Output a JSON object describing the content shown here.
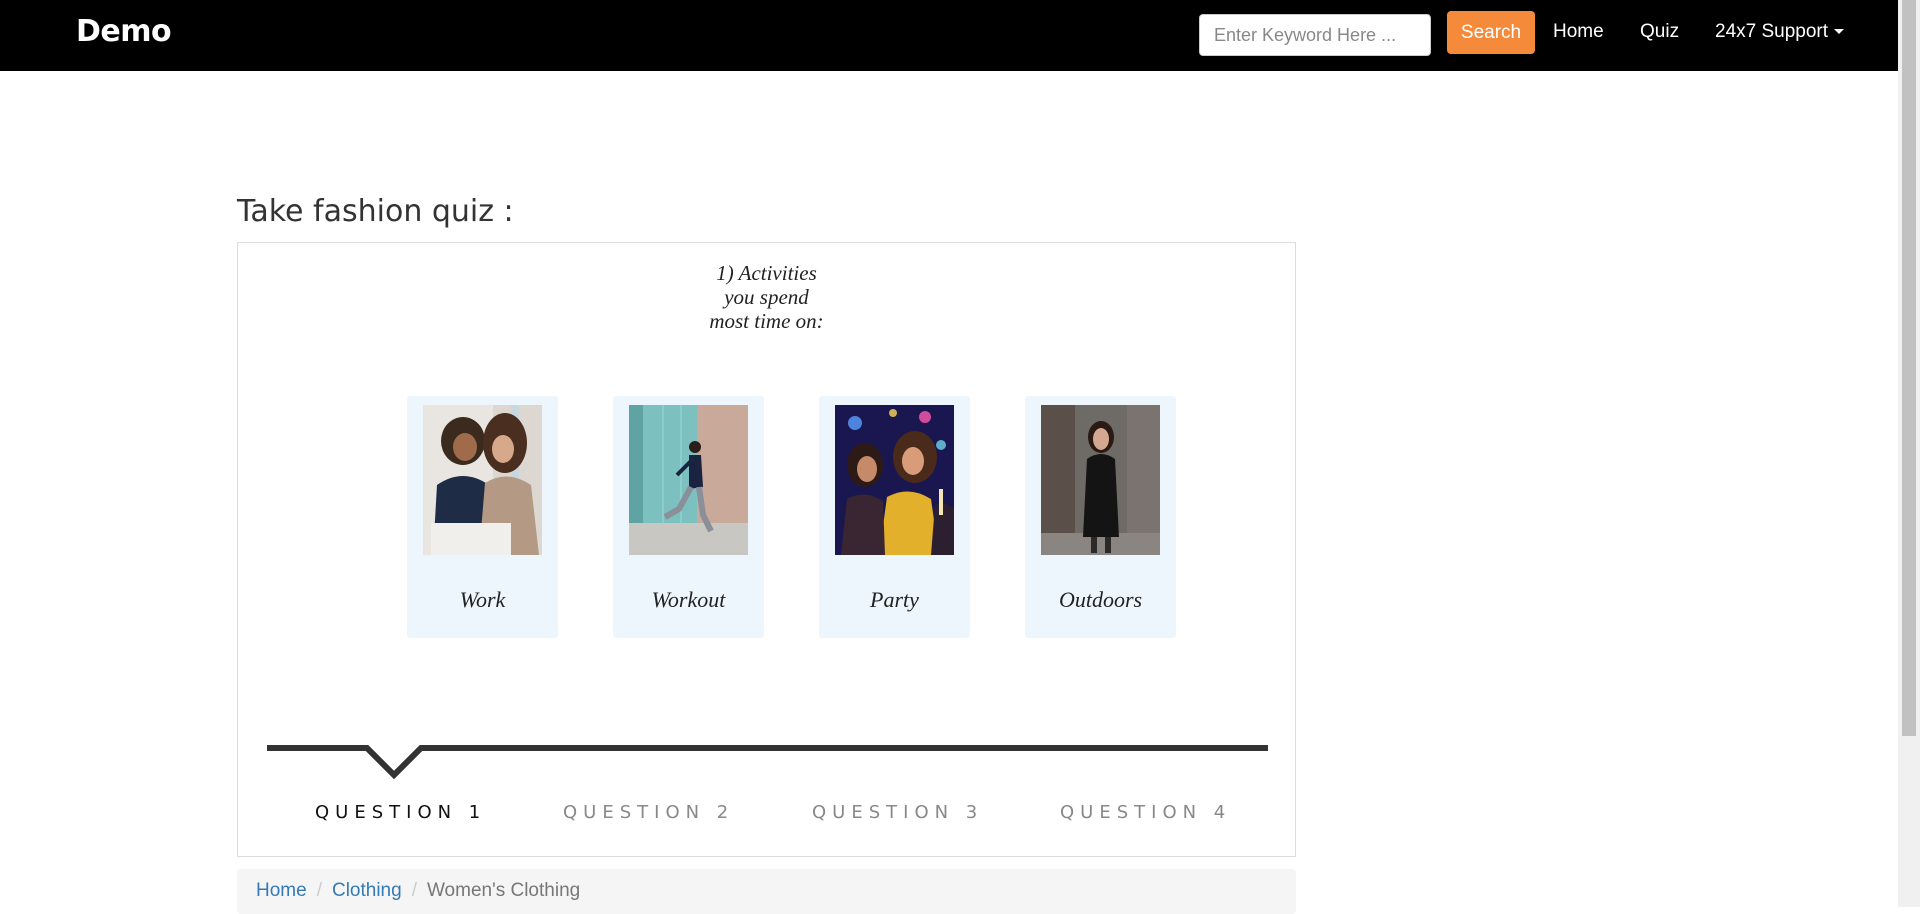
{
  "navbar": {
    "brand": "Demo",
    "search_placeholder": "Enter Keyword Here ...",
    "search_label": "Search",
    "links": [
      "Home",
      "Quiz",
      "24x7 Support"
    ]
  },
  "quiz": {
    "heading": "Take fashion quiz :",
    "question_lines": [
      "1) Activities",
      "you spend",
      "most time on:"
    ],
    "options": [
      {
        "label": "Work",
        "image": "two women at work photo"
      },
      {
        "label": "Workout",
        "image": "woman jogging photo"
      },
      {
        "label": "Party",
        "image": "women partying photo"
      },
      {
        "label": "Outdoors",
        "image": "woman in black jacket outdoors photo"
      }
    ],
    "steps": [
      "QUESTION 1",
      "QUESTION 2",
      "QUESTION 3",
      "QUESTION 4"
    ],
    "active_step": 1
  },
  "breadcrumb": {
    "items": [
      "Home",
      "Clothing"
    ],
    "current": "Women's Clothing"
  },
  "colors": {
    "navbar_bg": "#000000",
    "search_button": "#f58b3a",
    "card_bg": "#eef6fd",
    "link": "#337ab7"
  }
}
